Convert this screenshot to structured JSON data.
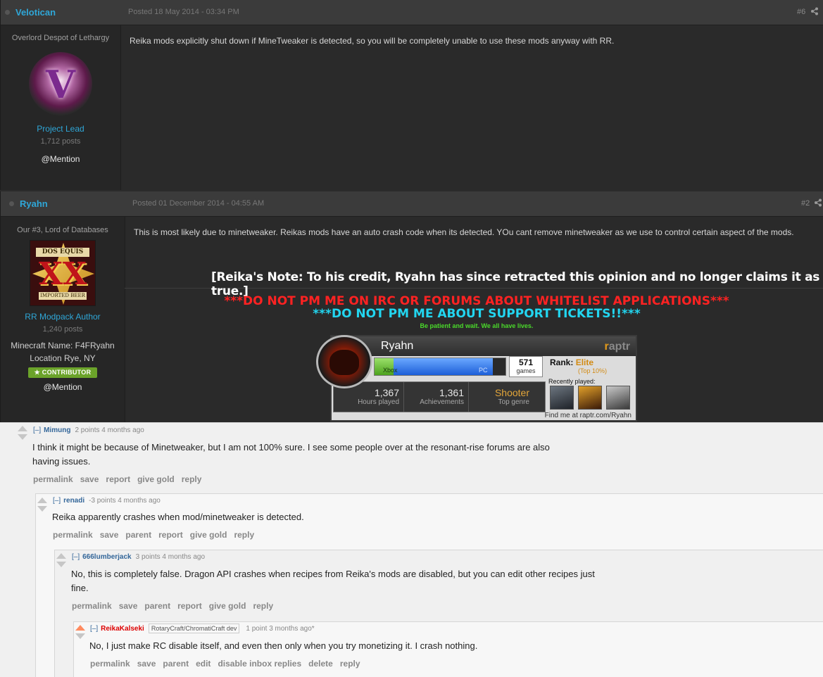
{
  "posts": [
    {
      "author": "Velotican",
      "posted": "Posted 18 May 2014 - 03:34 PM",
      "number": "#6",
      "member_title": "Overlord Despot of Lethargy",
      "avatar_glyph": "V",
      "group": "Project Lead",
      "post_count": "1,712 posts",
      "mention": "@Mention",
      "body": "Reika mods explicitly shut down if MineTweaker is detected, so you will be completely unable to use these mods anyway with RR."
    },
    {
      "author": "Ryahn",
      "posted": "Posted 01 December 2014 - 04:55 AM",
      "number": "#2",
      "member_title": "Our #3, Lord of Databases",
      "avatar_top": "DOS EQUIS",
      "avatar_mid": "XX",
      "avatar_bottom": "IMPORTED BEER",
      "group": "RR Modpack Author",
      "post_count": "1,240 posts",
      "minecraft_name": "Minecraft Name: F4FRyahn",
      "location": "Location Rye, NY",
      "badge": "CONTRIBUTOR",
      "mention": "@Mention",
      "body": "This is most likely due to minetweaker. Reikas mods have an auto crash code when its detected. YOu cant remove minetweaker as we use to control certain aspect of the mods."
    }
  ],
  "signature": {
    "note": "[Reika's Note: To his credit, Ryahn has since retracted this opinion and no longer claims it as true.]",
    "line1": "***DO NOT PM ME ON IRC OR FORUMS ABOUT WHITELIST APPLICATIONS***",
    "line2": "***DO NOT PM ME ABOUT SUPPORT TICKETS!!***",
    "line3": "Be patient and wait. We all have lives."
  },
  "raptr": {
    "name": "Ryahn",
    "logo_prefix": "r",
    "logo_rest": "aptr",
    "xbox_label": "Xbox",
    "pc_label": "PC",
    "games_count": "571",
    "games_label": "games",
    "rank_label": "Rank:",
    "rank_value": "Elite",
    "rank_top": "(Top 10%)",
    "hours_value": "1,367",
    "hours_label": "Hours played",
    "achievements_value": "1,361",
    "achievements_label": "Achievements",
    "genre_value": "Shooter",
    "genre_label": "Top genre",
    "recently_played": "Recently played:",
    "find_me": "Find me at raptr.com/Ryahn",
    "xbox_share": 0.17,
    "pc_share": 0.83
  },
  "comments": [
    {
      "toggle": "[–]",
      "author": "Mimung",
      "points": "2 points 4 months ago",
      "text_line1": "I think it might be because of Minetweaker, but I am not 100% sure. I see some people over at the resonant-rise forums are also",
      "text_line2": "having issues.",
      "links": [
        "permalink",
        "save",
        "report",
        "give gold",
        "reply"
      ]
    },
    {
      "toggle": "[–]",
      "author": "renadi",
      "points": "-3 points 4 months ago",
      "text_line1": "Reika apparently crashes when mod/minetweaker is detected.",
      "links": [
        "permalink",
        "save",
        "parent",
        "report",
        "give gold",
        "reply"
      ]
    },
    {
      "toggle": "[–]",
      "author": "666lumberjack",
      "points": "3 points 4 months ago",
      "text_line1": "No, this is completely false. Dragon API crashes when recipes from Reika's mods are disabled, but you can edit other recipes just",
      "text_line2": "fine.",
      "links": [
        "permalink",
        "save",
        "parent",
        "report",
        "give gold",
        "reply"
      ]
    },
    {
      "toggle": "[–]",
      "author": "ReikaKalseki",
      "flair": "RotaryCraft/ChromatiCraft dev",
      "points": "1 point 3 months ago*",
      "text_line1": "No, I just make RC disable itself, and even then only when you try monetizing it. I crash nothing.",
      "links": [
        "permalink",
        "save",
        "parent",
        "edit",
        "disable inbox replies",
        "delete",
        "reply"
      ]
    }
  ],
  "colors": {
    "author_link": "#2fa7d8",
    "warning_red": "#ff2222",
    "warning_cyan": "#22d6f0",
    "patience_green": "#4ad92a",
    "reddit_link": "#336699",
    "admin_red": "#dd0000",
    "upvote_orange": "#ff8b60"
  }
}
